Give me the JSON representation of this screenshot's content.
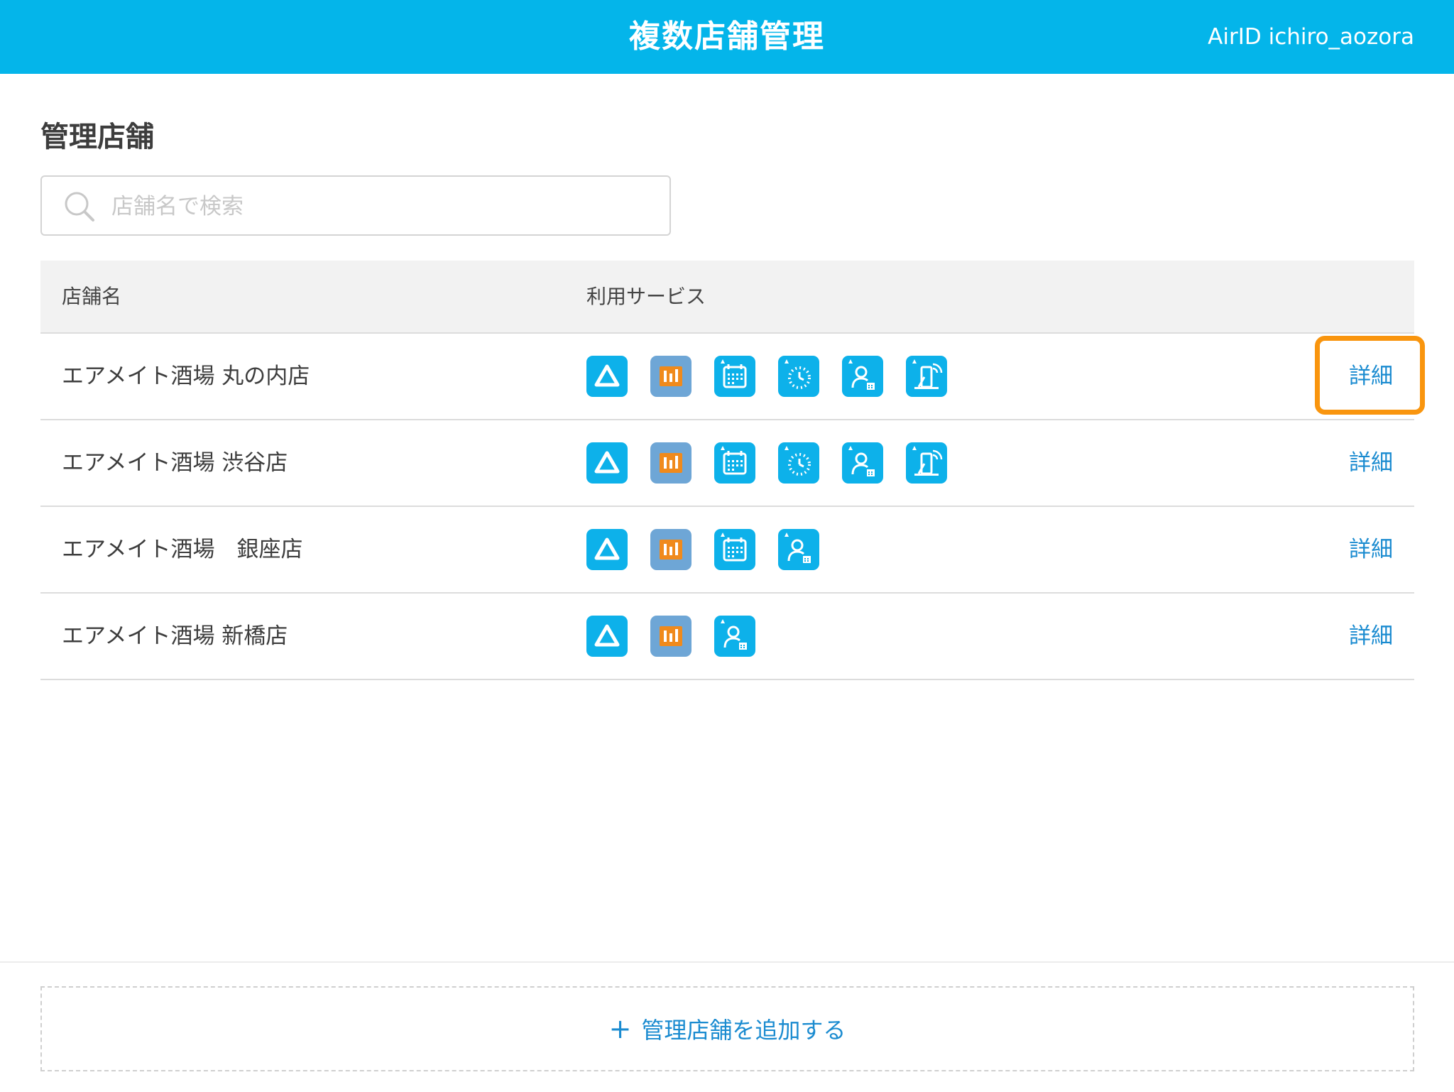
{
  "header": {
    "title": "複数店舗管理",
    "account": "AirID ichiro_aozora"
  },
  "main": {
    "section_title": "管理店舗",
    "search": {
      "placeholder": "店舗名で検索",
      "value": ""
    },
    "table": {
      "headers": {
        "name": "店舗名",
        "services": "利用サービス"
      },
      "rows": [
        {
          "name": "エアメイト酒場 丸の内店",
          "services": [
            "airid",
            "order",
            "reserve",
            "wait",
            "shift",
            "pay"
          ],
          "action": "詳細"
        },
        {
          "name": "エアメイト酒場 渋谷店",
          "services": [
            "airid",
            "order",
            "reserve",
            "wait",
            "shift",
            "pay"
          ],
          "action": "詳細"
        },
        {
          "name": "エアメイト酒場　銀座店",
          "services": [
            "airid",
            "order",
            "reserve",
            "shift"
          ],
          "action": "詳細"
        },
        {
          "name": "エアメイト酒場 新橋店",
          "services": [
            "airid",
            "order",
            "shift"
          ],
          "action": "詳細"
        }
      ]
    }
  },
  "footer": {
    "add_plus": "+",
    "add_label": "管理店舗を追加する"
  },
  "colors": {
    "header_bg": "#04b5ea",
    "link": "#1a8bd0",
    "highlight": "#f9950e",
    "icon_blue": "#0db1ea",
    "icon_order_bg": "#6ea6d6",
    "icon_order_fg": "#f08a1c"
  }
}
